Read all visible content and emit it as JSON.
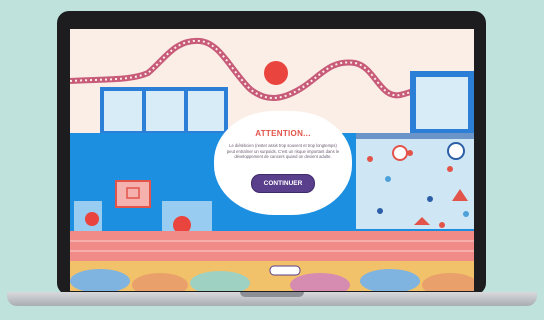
{
  "overlay": {
    "title": "ATTENTION...",
    "message": "Le diététicien (rester assis trop souvent et trop longtemps) peut entraîner un surpoids. C'est un risque important dans le développement de cancers quand on devient adulte.",
    "continue_label": "CONTINUER"
  },
  "colors": {
    "background": "#bfe3dc",
    "wall_blue": "#1c8fe0",
    "track": "#f08b87",
    "accent_red": "#e2544a",
    "button": "#5a3f8c"
  }
}
